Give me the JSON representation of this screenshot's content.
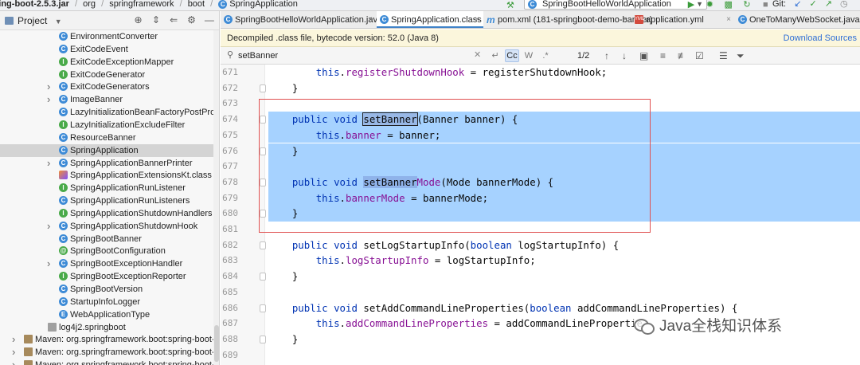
{
  "breadcrumbs": {
    "jar": "ring-boot-2.5.3.jar",
    "items": [
      "org",
      "springframework",
      "boot"
    ],
    "current": "SpringApplication"
  },
  "toolbar": {
    "run_config": "SpringBootHelloWorldApplication",
    "git_label": "Git:"
  },
  "sidebar": {
    "title": "Project",
    "items": [
      {
        "label": "EnvironmentConverter",
        "icon": "class-icon",
        "expand": false,
        "indent": 74
      },
      {
        "label": "ExitCodeEvent",
        "icon": "class-icon",
        "expand": false,
        "indent": 74
      },
      {
        "label": "ExitCodeExceptionMapper",
        "icon": "interface-icon",
        "expand": false,
        "indent": 74
      },
      {
        "label": "ExitCodeGenerator",
        "icon": "interface-icon",
        "expand": false,
        "indent": 74
      },
      {
        "label": "ExitCodeGenerators",
        "icon": "class-icon",
        "expand": true,
        "indent": 74
      },
      {
        "label": "ImageBanner",
        "icon": "class-icon",
        "expand": true,
        "indent": 74
      },
      {
        "label": "LazyInitializationBeanFactoryPostProcessor",
        "icon": "class-icon",
        "expand": false,
        "indent": 74
      },
      {
        "label": "LazyInitializationExcludeFilter",
        "icon": "interface-icon",
        "expand": false,
        "indent": 74
      },
      {
        "label": "ResourceBanner",
        "icon": "class-icon",
        "expand": false,
        "indent": 74
      },
      {
        "label": "SpringApplication",
        "icon": "class-icon",
        "expand": false,
        "indent": 74,
        "selected": true
      },
      {
        "label": "SpringApplicationBannerPrinter",
        "icon": "class-icon",
        "expand": true,
        "indent": 74
      },
      {
        "label": "SpringApplicationExtensionsKt.class",
        "icon": "kotlin-icon",
        "expand": false,
        "indent": 74
      },
      {
        "label": "SpringApplicationRunListener",
        "icon": "interface-icon",
        "expand": false,
        "indent": 74
      },
      {
        "label": "SpringApplicationRunListeners",
        "icon": "class-icon",
        "expand": false,
        "indent": 74
      },
      {
        "label": "SpringApplicationShutdownHandlers",
        "icon": "interface-icon",
        "expand": false,
        "indent": 74
      },
      {
        "label": "SpringApplicationShutdownHook",
        "icon": "class-icon",
        "expand": true,
        "indent": 74
      },
      {
        "label": "SpringBootBanner",
        "icon": "class-icon",
        "expand": false,
        "indent": 74
      },
      {
        "label": "SpringBootConfiguration",
        "icon": "annotation-icon",
        "expand": false,
        "indent": 74
      },
      {
        "label": "SpringBootExceptionHandler",
        "icon": "class-icon",
        "expand": true,
        "indent": 74
      },
      {
        "label": "SpringBootExceptionReporter",
        "icon": "interface-icon",
        "expand": false,
        "indent": 74
      },
      {
        "label": "SpringBootVersion",
        "icon": "class-icon",
        "expand": false,
        "indent": 74
      },
      {
        "label": "StartupInfoLogger",
        "icon": "class-icon",
        "expand": false,
        "indent": 74
      },
      {
        "label": "WebApplicationType",
        "icon": "enum-icon",
        "expand": false,
        "indent": 74
      },
      {
        "label": "log4j2.springboot",
        "icon": "file-icon",
        "expand": false,
        "indent": 60
      },
      {
        "label": "Maven: org.springframework.boot:spring-boot-autocor",
        "icon": "library-icon",
        "expand": true,
        "indent": 30
      },
      {
        "label": "Maven: org.springframework.boot:spring-boot-autocor",
        "icon": "library-icon",
        "expand": true,
        "indent": 30
      },
      {
        "label": "Maven: org.springframework.boot:spring-boot-configu",
        "icon": "library-icon",
        "expand": true,
        "indent": 30
      }
    ]
  },
  "tabs": [
    {
      "label": "SpringBootHelloWorldApplication.java",
      "icon": "class-icon",
      "active": false
    },
    {
      "label": "SpringApplication.class",
      "icon": "class-icon",
      "active": true
    },
    {
      "label": "pom.xml (181-springboot-demo-banner)",
      "icon": "maven-icon",
      "active": false
    },
    {
      "label": "application.yml",
      "icon": "yaml-icon",
      "active": false
    },
    {
      "label": "OneToManyWebSocket.java",
      "icon": "class-icon",
      "active": false
    }
  ],
  "notice": {
    "message": "Decompiled .class file, bytecode version: 52.0 (Java 8)",
    "action": "Download Sources"
  },
  "search": {
    "value": "setBanner",
    "count": "1/2",
    "opt_case": "Cc",
    "opt_words": "W",
    "opt_regex": ".*"
  },
  "code": {
    "lines": [
      {
        "no": "671",
        "parts": [
          {
            "t": "        "
          },
          {
            "t": "this",
            "c": "kw"
          },
          {
            "t": "."
          },
          {
            "t": "registerShutdownHook",
            "c": "fl"
          },
          {
            "t": " = registerShutdownHook;"
          }
        ]
      },
      {
        "no": "672",
        "parts": [
          {
            "t": "    }"
          }
        ]
      },
      {
        "no": "673",
        "parts": [
          {
            "t": ""
          }
        ]
      },
      {
        "no": "674",
        "hl": true,
        "parts": [
          {
            "t": "    "
          },
          {
            "t": "public",
            "c": "kw"
          },
          {
            "t": " "
          },
          {
            "t": "void",
            "c": "kw"
          },
          {
            "t": " "
          },
          {
            "t": "setBanner",
            "c": "mhl"
          },
          {
            "t": "(Banner banner) {"
          }
        ]
      },
      {
        "no": "675",
        "hl": true,
        "parts": [
          {
            "t": "        "
          },
          {
            "t": "this",
            "c": "kw"
          },
          {
            "t": "."
          },
          {
            "t": "banner",
            "c": "fl"
          },
          {
            "t": " = banner;"
          }
        ]
      },
      {
        "no": "676",
        "hl": true,
        "parts": [
          {
            "t": "    }"
          }
        ]
      },
      {
        "no": "677",
        "hl": true,
        "parts": [
          {
            "t": ""
          }
        ]
      },
      {
        "no": "678",
        "hl": true,
        "parts": [
          {
            "t": "    "
          },
          {
            "t": "public",
            "c": "kw"
          },
          {
            "t": " "
          },
          {
            "t": "void",
            "c": "kw"
          },
          {
            "t": " "
          },
          {
            "t": "setBanner",
            "c": "mhl2"
          },
          {
            "t": "Mode",
            "c": "fl"
          },
          {
            "t": "(Mode bannerMode) {"
          }
        ]
      },
      {
        "no": "679",
        "hl": true,
        "parts": [
          {
            "t": "        "
          },
          {
            "t": "this",
            "c": "kw"
          },
          {
            "t": "."
          },
          {
            "t": "bannerMode",
            "c": "fl"
          },
          {
            "t": " = bannerMode;"
          }
        ]
      },
      {
        "no": "680",
        "hl": true,
        "parts": [
          {
            "t": "    }"
          }
        ]
      },
      {
        "no": "681",
        "parts": [
          {
            "t": ""
          }
        ]
      },
      {
        "no": "682",
        "parts": [
          {
            "t": "    "
          },
          {
            "t": "public",
            "c": "kw"
          },
          {
            "t": " "
          },
          {
            "t": "void",
            "c": "kw"
          },
          {
            "t": " setLogStartupInfo("
          },
          {
            "t": "boolean",
            "c": "kw"
          },
          {
            "t": " logStartupInfo) {"
          }
        ]
      },
      {
        "no": "683",
        "parts": [
          {
            "t": "        "
          },
          {
            "t": "this",
            "c": "kw"
          },
          {
            "t": "."
          },
          {
            "t": "logStartupInfo",
            "c": "fl"
          },
          {
            "t": " = logStartupInfo;"
          }
        ]
      },
      {
        "no": "684",
        "parts": [
          {
            "t": "    }"
          }
        ]
      },
      {
        "no": "685",
        "parts": [
          {
            "t": ""
          }
        ]
      },
      {
        "no": "686",
        "parts": [
          {
            "t": "    "
          },
          {
            "t": "public",
            "c": "kw"
          },
          {
            "t": " "
          },
          {
            "t": "void",
            "c": "kw"
          },
          {
            "t": " setAddCommandLineProperties("
          },
          {
            "t": "boolean",
            "c": "kw"
          },
          {
            "t": " addCommandLineProperties) {"
          }
        ]
      },
      {
        "no": "687",
        "parts": [
          {
            "t": "        "
          },
          {
            "t": "this",
            "c": "kw"
          },
          {
            "t": "."
          },
          {
            "t": "addCommandLineProperties",
            "c": "fl"
          },
          {
            "t": " = addCommandLinePropertie"
          }
        ]
      },
      {
        "no": "688",
        "parts": [
          {
            "t": "    }"
          }
        ]
      },
      {
        "no": "689",
        "parts": [
          {
            "t": ""
          }
        ]
      }
    ]
  },
  "watermark": {
    "text": "Java全栈知识体系"
  },
  "colors": {
    "selection": "#a6d2ff",
    "keyword": "#0033b3",
    "field": "#871094",
    "annotation_box": "#e05050",
    "class_icon": "#3e8bd6",
    "interface_icon": "#4aaa4a"
  }
}
